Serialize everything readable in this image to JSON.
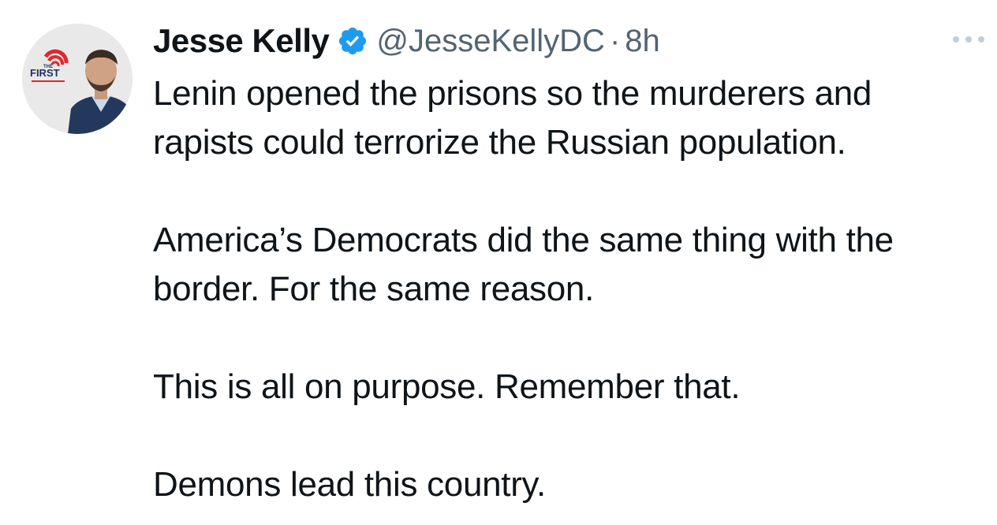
{
  "tweet": {
    "author": {
      "name": "Jesse Kelly",
      "handle": "@JesseKellyDC",
      "verified": true,
      "avatar_badge_small": "THE",
      "avatar_badge_text": "FIRST"
    },
    "separator": "·",
    "time": "8h",
    "more_icon": "ellipsis-icon",
    "paragraphs": [
      "Lenin opened the prisons so the murderers and\nrapists could terrorize the Russian population.",
      "America’s Democrats did the same thing with the\nborder. For the same reason.",
      "This is all on purpose. Remember that.",
      "Demons lead this country."
    ]
  },
  "colors": {
    "verified_blue": "#1d9bf0",
    "secondary_text": "#536471",
    "primary_text": "#0f1419",
    "badge_red": "#e0282e",
    "badge_navy": "#1c2f5c"
  }
}
